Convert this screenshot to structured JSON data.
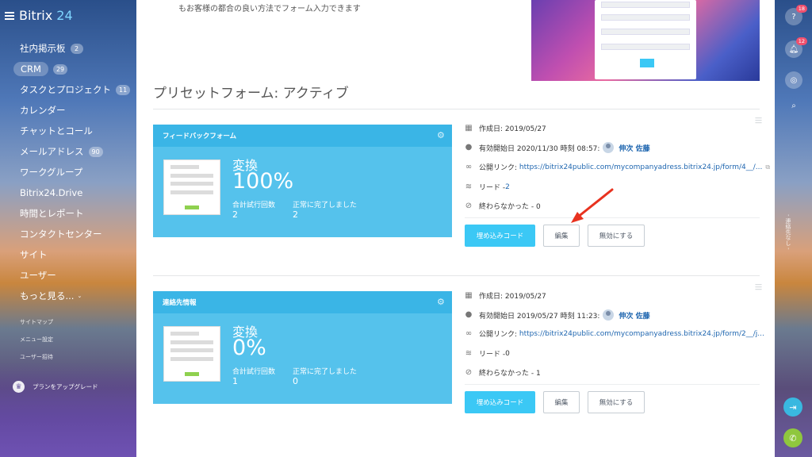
{
  "app": {
    "logo_name": "Bitrix",
    "logo_num": "24"
  },
  "sidebar": {
    "items": [
      {
        "label": "社内掲示板",
        "badge": "2"
      },
      {
        "label": "CRM",
        "badge": "29"
      },
      {
        "label": "タスクとプロジェクト",
        "badge": "11"
      },
      {
        "label": "カレンダー",
        "badge": ""
      },
      {
        "label": "チャットとコール",
        "badge": ""
      },
      {
        "label": "メールアドレス",
        "badge": "90"
      },
      {
        "label": "ワークグループ",
        "badge": ""
      },
      {
        "label": "Bitrix24.Drive",
        "badge": ""
      },
      {
        "label": "時間とレポート",
        "badge": ""
      },
      {
        "label": "コンタクトセンター",
        "badge": ""
      },
      {
        "label": "サイト",
        "badge": ""
      },
      {
        "label": "ユーザー",
        "badge": ""
      },
      {
        "label": "もっと見る...",
        "badge": ""
      }
    ],
    "sitemap": "サイトマップ",
    "menu_settings": "メニュー設定",
    "invite": "ユーザー招待",
    "upgrade": "プランをアップグレード"
  },
  "main": {
    "top_text": "もお客様の都合の良い方法でフォーム入力できます",
    "section_title": "プリセットフォーム: アクティブ",
    "forms": [
      {
        "name": "フィードバックフォーム",
        "conversion_label": "変換",
        "conversion_value": "100%",
        "attempts_label": "合計試行回数",
        "attempts_value": "2",
        "completed_label": "正常に完了しました",
        "completed_value": "2",
        "created": "作成日: 2019/05/27",
        "active_from": "有効開始日 2020/11/30 時刻 08:57:",
        "user": "伸次 佐藤",
        "public_link_label": "公開リンク:",
        "public_link": "https://bitrix24public.com/mycompanyadress.bitrix24.jp/form/4__/...",
        "leads_label": "リード - ",
        "leads_value": "2",
        "unfinished": "終わらなかった - 0",
        "embed_button": "埋め込みコード",
        "edit_button": "編集",
        "disable_button": "無効にする"
      },
      {
        "name": "連絡先情報",
        "conversion_label": "変換",
        "conversion_value": "0%",
        "attempts_label": "合計試行回数",
        "attempts_value": "1",
        "completed_label": "正常に完了しました",
        "completed_value": "0",
        "created": "作成日: 2019/05/27",
        "active_from": "有効開始日 2019/05/27 時刻 11:23:",
        "user": "伸次 佐藤",
        "public_link_label": "公開リンク:",
        "public_link": "https://bitrix24public.com/mycompanyadress.bitrix24.jp/form/2__/j...",
        "leads_label": "リード - ",
        "leads_value": "0",
        "unfinished": "終わらなかった - 1",
        "embed_button": "埋め込みコード",
        "edit_button": "編集",
        "disable_button": "無効にする"
      }
    ]
  },
  "rightbar": {
    "help_badge": "18",
    "notify_badge": "12",
    "vertical_text": "- 連絡先なし -"
  },
  "colors": {
    "accent": "#3bc8f5",
    "card": "#55c2ec",
    "badge": "#f0506e",
    "arrow": "#e8321f"
  }
}
